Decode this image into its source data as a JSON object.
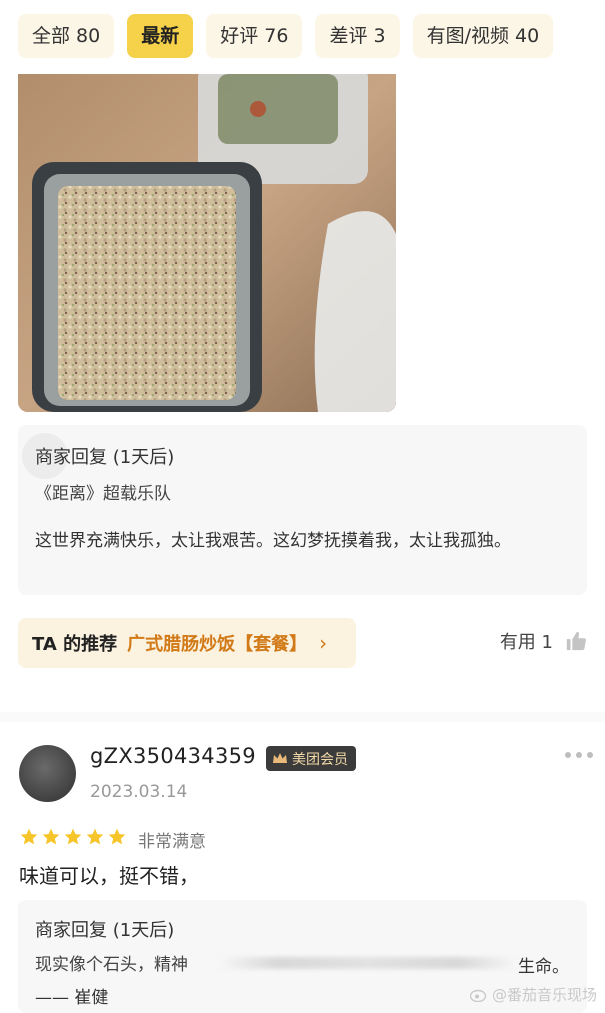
{
  "filters": [
    {
      "label": "全部 80"
    },
    {
      "label": "最新"
    },
    {
      "label": "好评 76"
    },
    {
      "label": "差评 3"
    },
    {
      "label": "有图/视频 40"
    }
  ],
  "review1": {
    "reply": {
      "title": "商家回复 (1天后)",
      "song": "《距离》超载乐队",
      "body": "这世界充满快乐，太让我艰苦。这幻梦抚摸着我，太让我孤独。"
    },
    "recommend": {
      "label": "TA 的推荐",
      "dish": "广式腊肠炒饭【套餐】",
      "arrow": "›"
    },
    "useful": "有用 1"
  },
  "review2": {
    "username": "gZX350434359",
    "member_badge": "美团会员",
    "date": "2023.03.14",
    "stars": 5,
    "rating_text": "非常满意",
    "text": "味道可以，挺不错，",
    "reply": {
      "title": "商家回复 (1天后)",
      "line_start": "现实像个石头，精神",
      "line_end": "生命。",
      "author": "—— 崔健"
    }
  },
  "watermark": "@番茄音乐现场",
  "colors": {
    "accent_yellow": "#f6d24a",
    "chip_bg": "#fbf6e6",
    "recommend_orange": "#d17a17",
    "star": "#f6c52a"
  }
}
